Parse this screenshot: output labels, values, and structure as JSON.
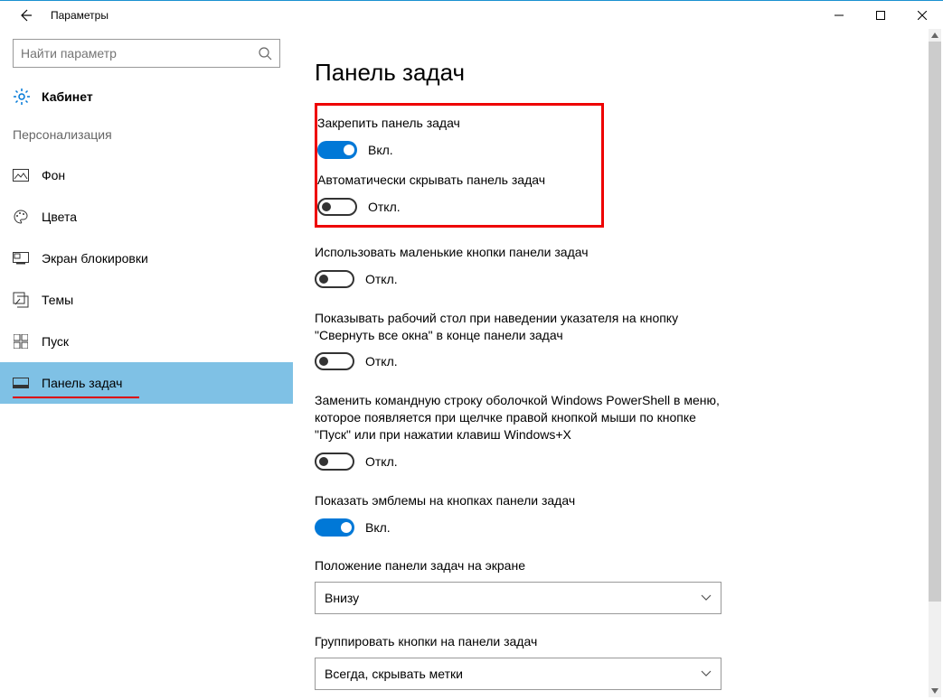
{
  "window": {
    "title": "Параметры"
  },
  "search": {
    "placeholder": "Найти параметр"
  },
  "home": {
    "label": "Кабинет"
  },
  "section": {
    "label": "Персонализация"
  },
  "nav": {
    "items": [
      {
        "label": "Фон"
      },
      {
        "label": "Цвета"
      },
      {
        "label": "Экран блокировки"
      },
      {
        "label": "Темы"
      },
      {
        "label": "Пуск"
      },
      {
        "label": "Панель задач"
      }
    ]
  },
  "page": {
    "title": "Панель задач"
  },
  "settings": {
    "lock": {
      "label": "Закрепить панель задач",
      "state": "Вкл."
    },
    "autohide": {
      "label": "Автоматически скрывать панель задач",
      "state": "Откл."
    },
    "small": {
      "label": "Использовать маленькие кнопки панели задач",
      "state": "Откл."
    },
    "peek": {
      "label": "Показывать рабочий стол при наведении указателя на кнопку \"Свернуть все окна\" в конце панели задач",
      "state": "Откл."
    },
    "powershell": {
      "label": "Заменить командную строку оболочкой Windows PowerShell в меню, которое появляется при щелчке правой кнопкой мыши по кнопке \"Пуск\" или при нажатии клавиш Windows+X",
      "state": "Откл."
    },
    "badges": {
      "label": "Показать эмблемы на кнопках панели задач",
      "state": "Вкл."
    }
  },
  "dropdowns": {
    "position": {
      "label": "Положение панели задач на экране",
      "value": "Внизу"
    },
    "combine": {
      "label": "Группировать кнопки на панели задач",
      "value": "Всегда, скрывать метки"
    }
  }
}
